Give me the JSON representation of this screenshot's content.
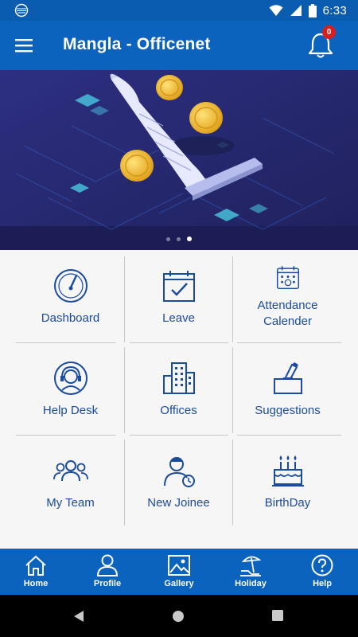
{
  "status_bar": {
    "time": "6:33",
    "icons": [
      "notification-icon",
      "wifi-icon",
      "signal-icon",
      "battery-icon"
    ]
  },
  "app_bar": {
    "title": "Mangla - Officenet",
    "notification_count": "0"
  },
  "banner": {
    "slide_count": 3,
    "active_slide": 3
  },
  "tiles": [
    {
      "label": "Dashboard",
      "icon": "speedometer-icon"
    },
    {
      "label": "Leave",
      "icon": "calendar-check-icon"
    },
    {
      "label": "Attendance\nCalender",
      "icon": "attendance-calendar-icon"
    },
    {
      "label": "Help Desk",
      "icon": "headset-support-icon"
    },
    {
      "label": "Offices",
      "icon": "office-buildings-icon"
    },
    {
      "label": "Suggestions",
      "icon": "suggestion-box-icon"
    },
    {
      "label": "My Team",
      "icon": "team-icon"
    },
    {
      "label": "New Joinee",
      "icon": "new-joinee-icon"
    },
    {
      "label": "BirthDay",
      "icon": "birthday-cake-icon"
    }
  ],
  "bottom_nav": [
    {
      "label": "Home",
      "icon": "home-icon"
    },
    {
      "label": "Profile",
      "icon": "profile-icon"
    },
    {
      "label": "Gallery",
      "icon": "gallery-icon"
    },
    {
      "label": "Holiday",
      "icon": "holiday-icon"
    },
    {
      "label": "Help",
      "icon": "help-icon"
    }
  ],
  "colors": {
    "primary": "#0b63bd",
    "status_bar": "#0a5cb0",
    "tile_text": "#1a4b9c",
    "badge": "#d81e1e",
    "grid_bg": "#f6f6f6"
  }
}
